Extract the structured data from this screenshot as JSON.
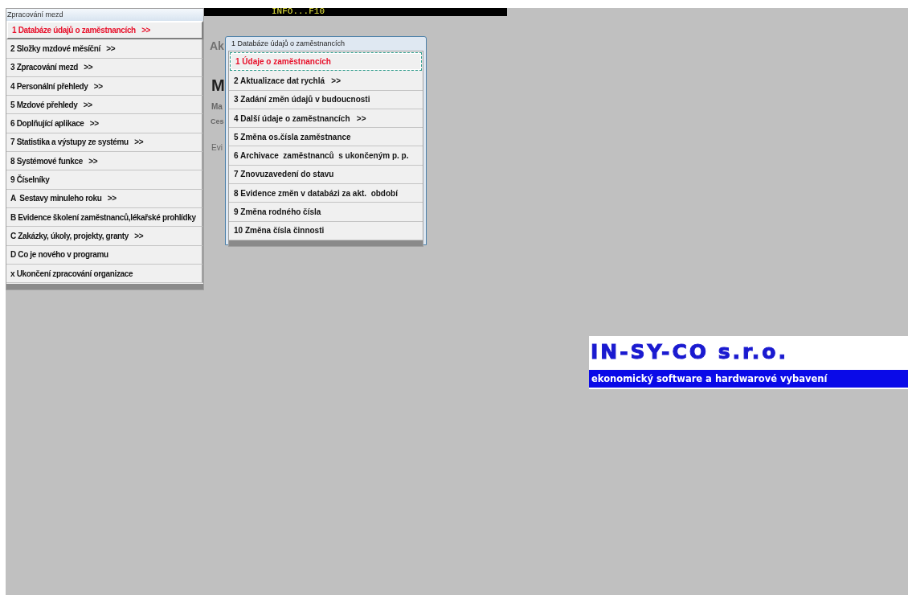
{
  "info_bar": {
    "text": "INFO...F10"
  },
  "background_labels": [
    "Ak",
    "M",
    "Ma",
    "Ces",
    "Evi"
  ],
  "main_menu": {
    "title": "Zpracování mezd",
    "items": [
      {
        "label": "1 Databáze údajů o zaměstnancích   >>",
        "selected": true
      },
      {
        "label": "2 Složky mzdové měsíční   >>",
        "selected": false
      },
      {
        "label": "3 Zpracování mezd   >>",
        "selected": false
      },
      {
        "label": "4 Personální přehledy   >>",
        "selected": false
      },
      {
        "label": "5 Mzdové přehledy   >>",
        "selected": false
      },
      {
        "label": "6 Doplňující aplikace   >>",
        "selected": false
      },
      {
        "label": "7 Statistika a výstupy ze systému   >>",
        "selected": false
      },
      {
        "label": "8 Systémové funkce   >>",
        "selected": false
      },
      {
        "label": "9 Číselníky",
        "selected": false
      },
      {
        "label": "A  Sestavy minuleho roku   >>",
        "selected": false
      },
      {
        "label": "B Evidence školení zaměstnanců,lékařské prohlídky",
        "selected": false
      },
      {
        "label": "C Zakázky, úkoly, projekty, granty   >>",
        "selected": false
      },
      {
        "label": "D Co je nového v programu",
        "selected": false
      },
      {
        "label": "x Ukončení zpracování organizace",
        "selected": false
      }
    ]
  },
  "submenu": {
    "title": "1 Databáze údajů o zaměstnancích",
    "items": [
      {
        "label": "1 Údaje o zaměstnancích",
        "selected": true
      },
      {
        "label": "2 Aktualizace dat rychlá   >>",
        "selected": false
      },
      {
        "label": "3 Zadání změn údajů v budoucnosti",
        "selected": false
      },
      {
        "label": "4 Další údaje o zaměstnancích   >>",
        "selected": false
      },
      {
        "label": "5 Změna os.čísla zaměstnance",
        "selected": false
      },
      {
        "label": "6 Archivace  zaměstnanců  s ukončeným p. p.",
        "selected": false
      },
      {
        "label": "7 Znovuzavedení do stavu",
        "selected": false
      },
      {
        "label": "8 Evidence změn v databázi za akt.  období",
        "selected": false
      },
      {
        "label": "9 Změna rodného čísla",
        "selected": false
      },
      {
        "label": "10 Změna čísla činnosti",
        "selected": false
      }
    ]
  },
  "logo": {
    "name": "IN-SY-CO s.r.o.",
    "tagline": "ekonomický software a hardwarové vybavení"
  }
}
